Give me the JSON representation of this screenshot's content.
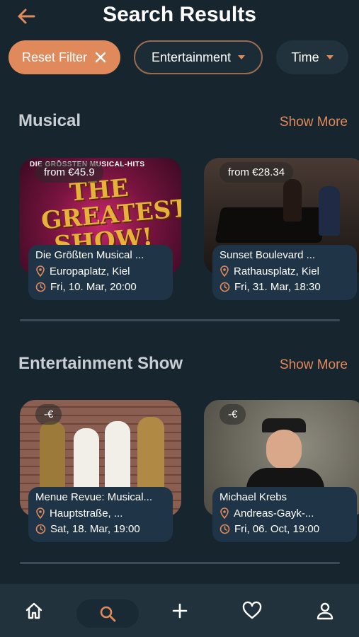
{
  "header": {
    "title": "Search Results"
  },
  "filters": {
    "reset_label": "Reset Filter",
    "entertainment_label": "Entertainment",
    "time_label": "Time"
  },
  "sections": [
    {
      "title": "Musical",
      "show_more": "Show More",
      "cards": [
        {
          "price": "from €45.9",
          "title": "Die Größten Musical ...",
          "location": "Europaplatz, Kiel",
          "date": "Fri, 10. Mar, 20:00",
          "poster_text": "DIE GRÖSSTEN MUSICAL-HITS",
          "poster_headline": "THE GREATEST SHOW!"
        },
        {
          "price": "from €28.34",
          "title": "Sunset Boulevard ...",
          "location": "Rathausplatz, Kiel",
          "date": "Fri, 31. Mar, 18:30"
        }
      ]
    },
    {
      "title": "Entertainment Show",
      "show_more": "Show More",
      "cards": [
        {
          "price": "-€",
          "title": "Menue Revue: Musical...",
          "location": "Hauptstraße, ...",
          "date": "Sat, 18. Mar, 19:00"
        },
        {
          "price": "-€",
          "title": "Michael Krebs",
          "location": "Andreas-Gayk-...",
          "date": "Fri, 06. Oct, 19:00"
        }
      ]
    }
  ],
  "tabbar": {
    "items": [
      "home-icon",
      "search-icon",
      "plus-icon",
      "heart-icon",
      "user-icon"
    ],
    "active": "search-icon"
  },
  "colors": {
    "accent": "#e08a5c",
    "background": "#17252f",
    "card_info": "#1f3446"
  }
}
